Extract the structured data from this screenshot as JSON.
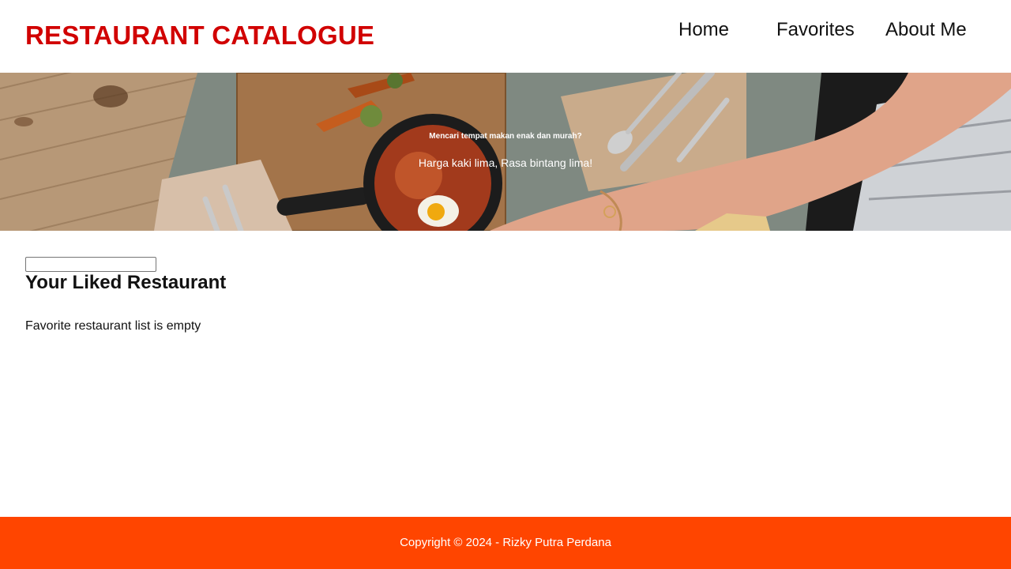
{
  "header": {
    "brand": "RESTAURANT CATALOGUE",
    "nav": [
      {
        "label": "Home"
      },
      {
        "label": "Favorites"
      },
      {
        "label": "About Me"
      }
    ]
  },
  "hero": {
    "subtitle": "Mencari tempat makan enak dan murah?",
    "tagline": "Harga kaki lima, Rasa bintang lima!"
  },
  "main": {
    "search": {
      "value": "",
      "placeholder": ""
    },
    "title": "Your Liked Restaurant",
    "empty_message": "Favorite restaurant list is empty"
  },
  "footer": {
    "text": "Copyright © 2024 - Rizky Putra Perdana"
  },
  "colors": {
    "brand": "#d10000",
    "footer_bg": "#ff4500",
    "hero_text": "#ffffff"
  }
}
